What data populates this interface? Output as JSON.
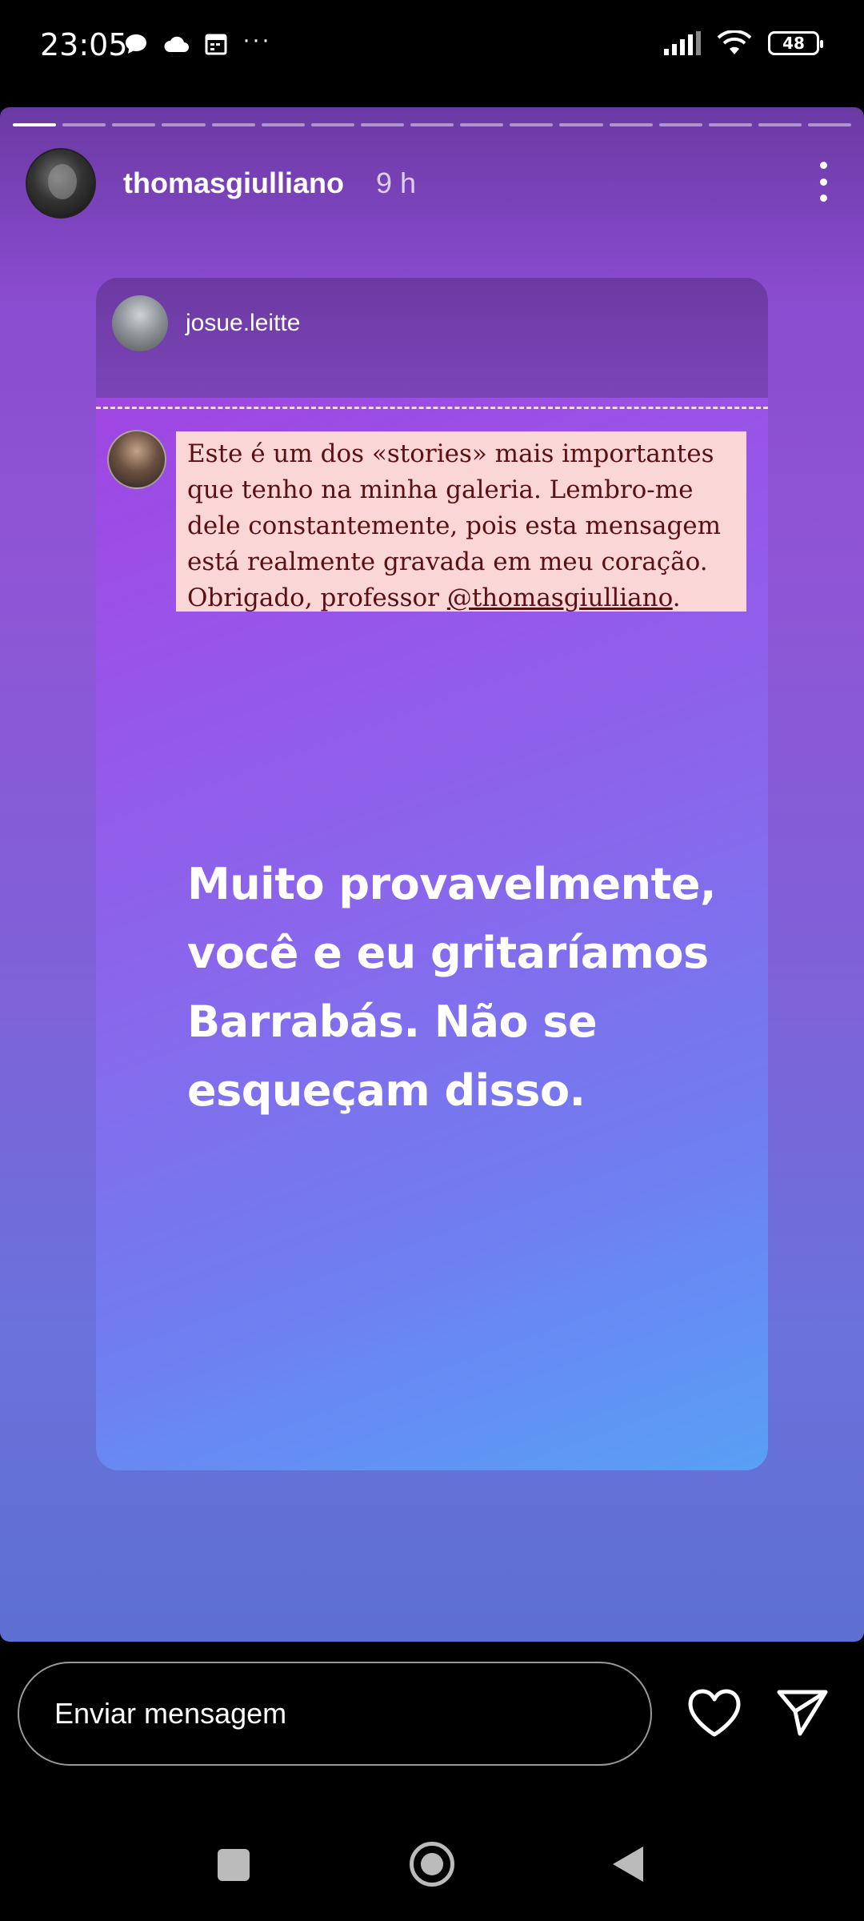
{
  "status_bar": {
    "time": "23:05",
    "more": "···",
    "battery": "48",
    "icons": [
      "chat-bubble-icon",
      "cloud-icon",
      "calendar-icon",
      "signal-icon",
      "wifi-icon",
      "battery-icon"
    ]
  },
  "story": {
    "username": "thomasgiulliano",
    "time_ago": "9 h",
    "progress_segments": 17,
    "progress_completed": 1
  },
  "reshared_post": {
    "username": "josue.leitte",
    "quote_lines": [
      "Este é um dos «stories» mais importantes",
      "que tenho na minha galeria. Lembro-me",
      "dele constantemente, pois esta mensagem",
      "está realmente gravada em meu coração."
    ],
    "quote_last_prefix": "Obrigado, professor ",
    "quote_mention": "@thomasgiulliano",
    "quote_last_suffix": ".",
    "big_text_lines": [
      "Muito provavelmente,",
      "você e eu gritaríamos",
      "Barrabás. Não se",
      "esqueçam disso."
    ]
  },
  "reply": {
    "placeholder": "Enviar mensagem"
  },
  "colors": {
    "quote_bg": "#fbd6d6",
    "quote_text": "#5a0f12",
    "story_top": "#6a3aa3",
    "card_end": "#58a0f6"
  }
}
